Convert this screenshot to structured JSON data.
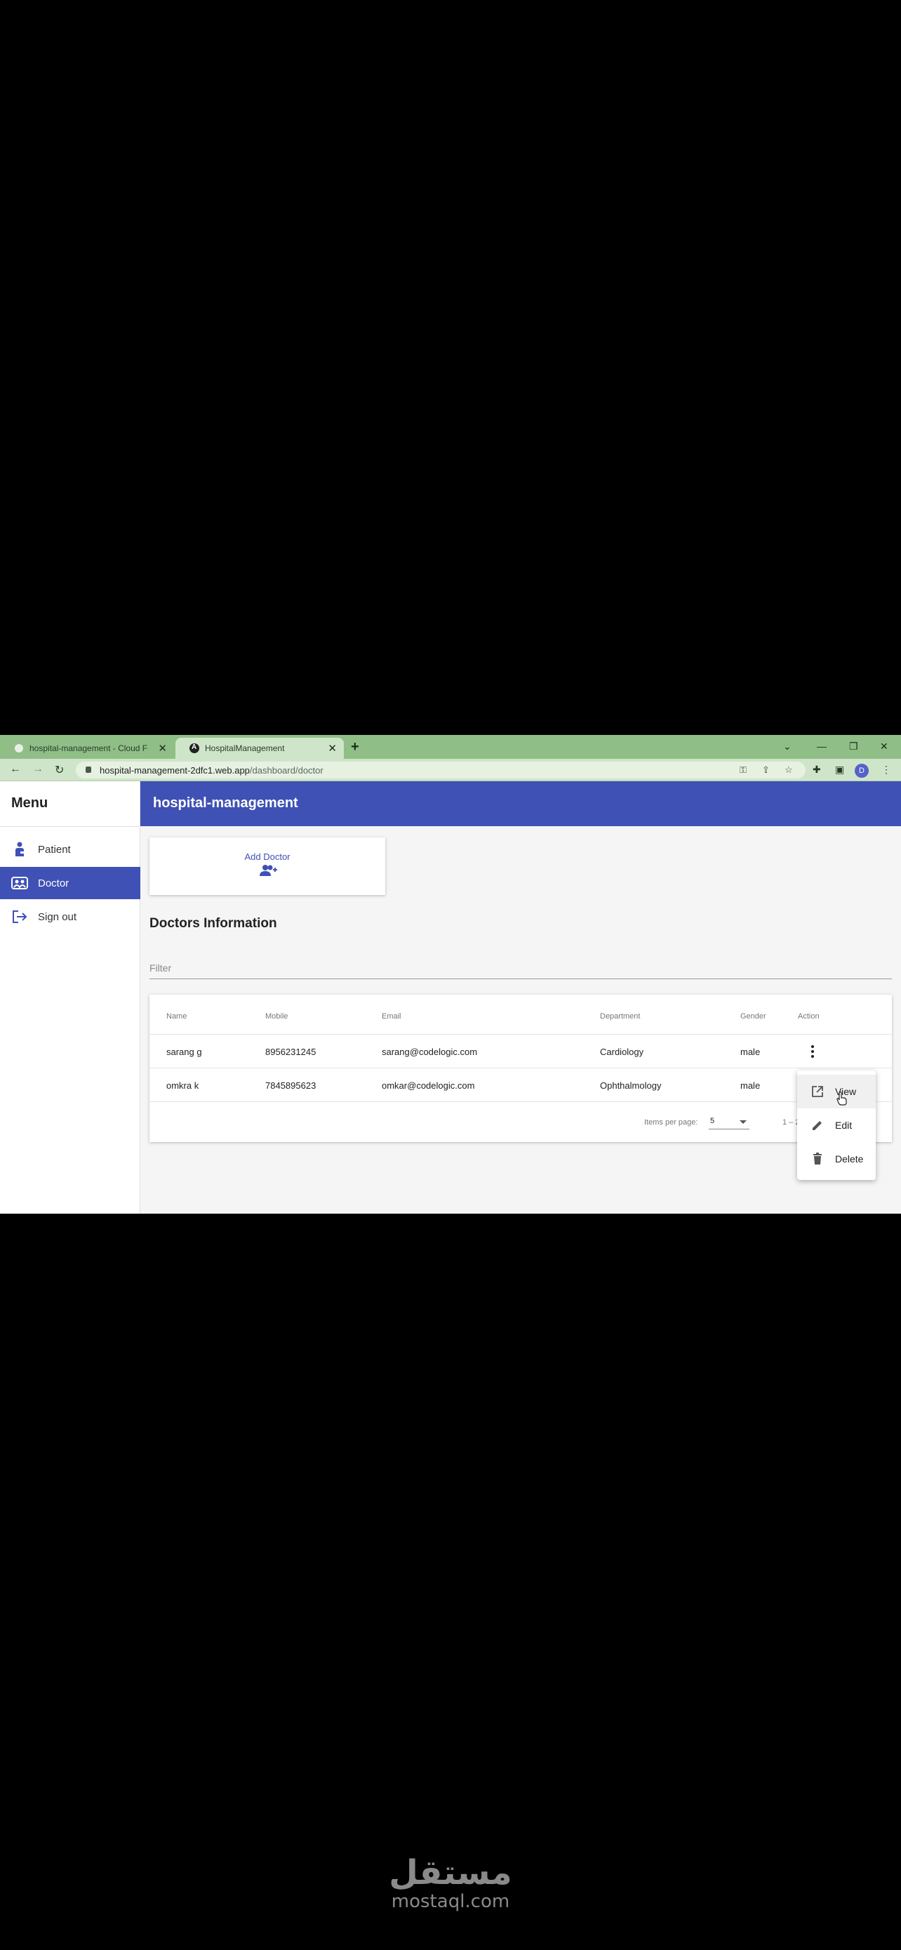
{
  "browser": {
    "tabs": [
      {
        "label": "hospital-management - Cloud F"
      },
      {
        "label": "HospitalManagement"
      }
    ],
    "url_host": "hospital-management-2dfc1.web.app",
    "url_path": "/dashboard/doctor",
    "profile_initial": "D"
  },
  "sidebar": {
    "title": "Menu",
    "items": [
      {
        "label": "Patient",
        "icon": "patient-icon"
      },
      {
        "label": "Doctor",
        "icon": "doctor-icon"
      },
      {
        "label": "Sign out",
        "icon": "sign-out-icon"
      }
    ]
  },
  "header": {
    "title": "hospital-management"
  },
  "main": {
    "add_doctor_label": "Add Doctor",
    "section_title": "Doctors Information",
    "filter_placeholder": "Filter",
    "table": {
      "columns": [
        "Name",
        "Mobile",
        "Email",
        "Department",
        "Gender",
        "Action"
      ],
      "rows": [
        [
          "sarang g",
          "8956231245",
          "sarang@codelogic.com",
          "Cardiology",
          "male"
        ],
        [
          "omkra k",
          "7845895623",
          "omkar@codelogic.com",
          "Ophthalmology",
          "male"
        ]
      ]
    },
    "paginator": {
      "items_per_page_label": "Items per page:",
      "page_size": "5",
      "range_label": "1 – 2 o"
    },
    "action_menu": [
      "View",
      "Edit",
      "Delete"
    ]
  },
  "watermark": {
    "arabic": "مستقل",
    "latin": "mostaql.com"
  },
  "colors": {
    "primary": "#3f51b5",
    "tab_strip": "#8fbf86",
    "background": "#000000"
  }
}
